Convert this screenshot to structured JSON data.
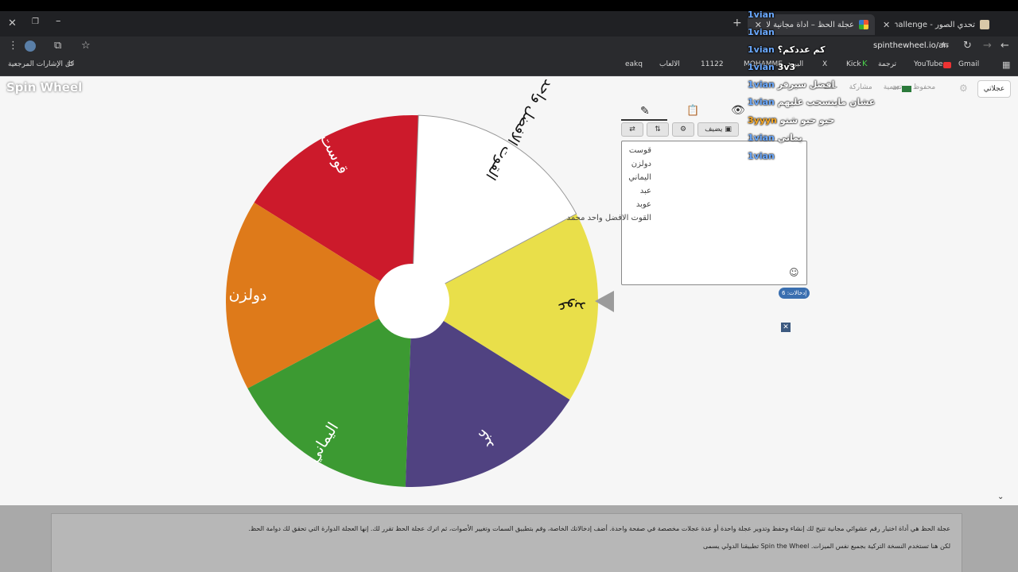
{
  "browser": {
    "tabs": [
      {
        "title": "تحدي الصور - Photo Challenge"
      },
      {
        "title": "عجلة الحظ – أداة مجانية لاختيار"
      }
    ],
    "address": "spinthewheel.io/ar",
    "bookmarks": {
      "all": "كل الإشارات المرجعية",
      "eakq": "eakq",
      "games": "الالعاب",
      "num": "11122",
      "mu": "MOHAMME",
      "mail": "البريد",
      "x": "X",
      "kick": "Kick",
      "translate": "ترجمة",
      "youtube": "YouTube",
      "gmail": "Gmail"
    }
  },
  "site": {
    "logo": "Spin Wheel",
    "my_wheels": "عجلاتي",
    "lang": "ar",
    "nav": [
      "محفوظ",
      "تسمية",
      "مشاركة",
      "حفظ"
    ]
  },
  "wheel": {
    "slices": [
      {
        "label": "قوست",
        "color": "#cc1a2b"
      },
      {
        "label": "دولزن",
        "color": "#de7a1a"
      },
      {
        "label": "اليماني",
        "color": "#3c9a32"
      },
      {
        "label": "عبد",
        "color": "#504281"
      },
      {
        "label": "عوبد",
        "color": "#e9df4a"
      },
      {
        "label": "القوت الافضل واحد ...",
        "color": "#ffffff"
      }
    ]
  },
  "editor": {
    "add_image": "يضيف",
    "entries": [
      "قوست",
      "دولزن",
      "اليماني",
      "عبد",
      "عوبد",
      "القوت الافضل واحد محمد"
    ],
    "count": "إدخالات: 6"
  },
  "chat": [
    {
      "name": "1vian",
      "msg": ""
    },
    {
      "name": "1vian",
      "msg": ""
    },
    {
      "name": "1vian",
      "msg": "كم عددكم؟"
    },
    {
      "name": "1vian",
      "msg": "3v3"
    },
    {
      "name": "1vian",
      "msg": "افضل سيرفر"
    },
    {
      "name": "1vian",
      "msg": "عشان ماينسحب عليهم"
    },
    {
      "name": "3yyyn",
      "msg": "حيو حيو شنو"
    },
    {
      "name": "1vian",
      "msg": "يماني"
    },
    {
      "name": "1vian",
      "msg": ""
    }
  ],
  "footer": {
    "line1": "عجلة الحظ هي أداة اختيار رقم عشوائي مجانية تتيح لك إنشاء وحفظ وتدوير عجلة واحدة أو عدة عجلات مخصصة في صفحة واحدة. أضف إدخالاتك الخاصة، وقم بتطبيق السمات وتغيير الأصوات، ثم اترك عجلة الحظ تقرر لك. إنها العجلة الدوارة التي تحقق لك دوامة الحظ.",
    "line2": "لكن هنا تستخدم النسخة التركية بجميع نفس الميزات. Spin the Wheel تطبيقنا الدولي يسمى"
  },
  "colors": {
    "pointer": "#9b9b9b",
    "chat_name": "#6aa9ff"
  }
}
